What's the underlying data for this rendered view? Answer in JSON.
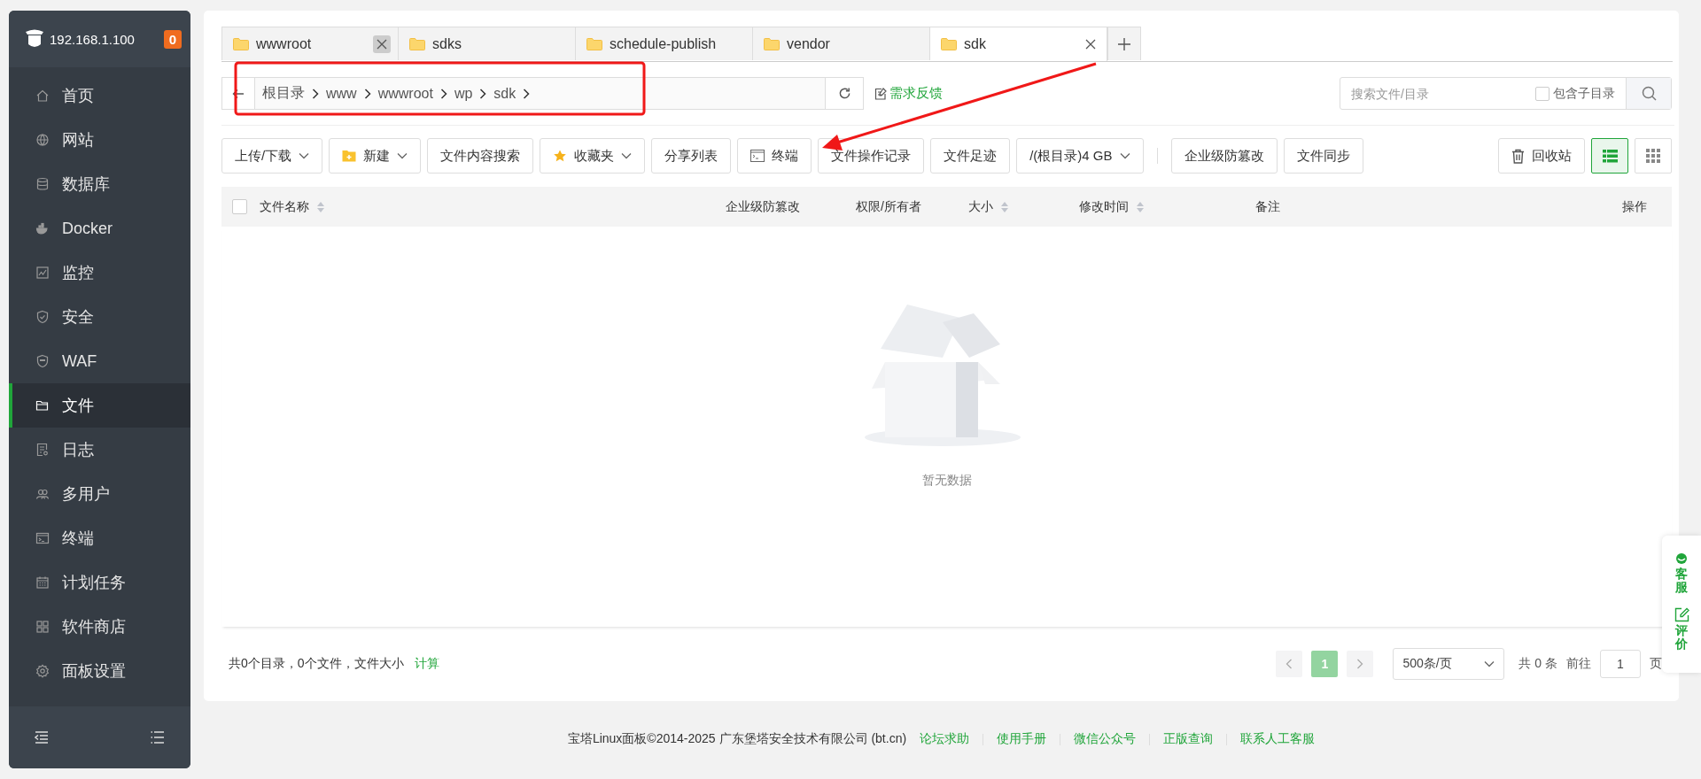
{
  "sidebar": {
    "host": "192.168.1.100",
    "badge": "0",
    "items": [
      {
        "label": "首页",
        "selected": false
      },
      {
        "label": "网站",
        "selected": false
      },
      {
        "label": "数据库",
        "selected": false
      },
      {
        "label": "Docker",
        "selected": false
      },
      {
        "label": "监控",
        "selected": false
      },
      {
        "label": "安全",
        "selected": false
      },
      {
        "label": "WAF",
        "selected": false
      },
      {
        "label": "文件",
        "selected": true
      },
      {
        "label": "日志",
        "selected": false
      },
      {
        "label": "多用户",
        "selected": false
      },
      {
        "label": "终端",
        "selected": false
      },
      {
        "label": "计划任务",
        "selected": false
      },
      {
        "label": "软件商店",
        "selected": false
      },
      {
        "label": "面板设置",
        "selected": false
      }
    ]
  },
  "tabs": [
    {
      "label": "wwwroot",
      "selected": false
    },
    {
      "label": "sdks",
      "selected": false
    },
    {
      "label": "schedule-publish",
      "selected": false
    },
    {
      "label": "vendor",
      "selected": false
    },
    {
      "label": "sdk",
      "selected": true
    }
  ],
  "breadcrumbs": [
    "根目录",
    "www",
    "wwwroot",
    "wp",
    "sdk"
  ],
  "feedback_link": "需求反馈",
  "search": {
    "placeholder": "搜索文件/目录",
    "include_subdirs": {
      "label": "包含子目录",
      "checked": false
    }
  },
  "toolbar": [
    {
      "label": "上传/下载",
      "dropdown": true
    },
    {
      "label": "新建",
      "dropdown": true
    },
    {
      "label": "文件内容搜索",
      "dropdown": false
    },
    {
      "label": "收藏夹",
      "dropdown": true
    },
    {
      "label": "分享列表",
      "dropdown": false
    },
    {
      "label": "终端",
      "dropdown": false
    },
    {
      "label": "文件操作记录",
      "dropdown": false
    },
    {
      "label": "文件足迹",
      "dropdown": false
    },
    {
      "label": "/(根目录)4 GB",
      "dropdown": true
    },
    {
      "label": "企业级防篡改",
      "dropdown": false
    },
    {
      "label": "文件同步",
      "dropdown": false
    }
  ],
  "recycle_button": "回收站",
  "views": [
    {
      "kind": "list",
      "selected": true
    },
    {
      "kind": "grid",
      "selected": false
    }
  ],
  "table": {
    "select_all": false,
    "columns": [
      {
        "label": "文件名称",
        "sortable": true
      },
      {
        "label": "企业级防篡改",
        "sortable": false
      },
      {
        "label": "权限/所有者",
        "sortable": false
      },
      {
        "label": "大小",
        "sortable": true
      },
      {
        "label": "修改时间",
        "sortable": true
      },
      {
        "label": "备注",
        "sortable": false
      },
      {
        "label": "操作",
        "sortable": false
      }
    ],
    "empty_text": "暂无数据"
  },
  "summary": {
    "text": "共0个目录，0个文件，文件大小",
    "link": "计算"
  },
  "pagination": {
    "pages": [
      {
        "label": "1",
        "selected": true
      }
    ],
    "page_size": "500条/页",
    "total": "共 0 条",
    "goto": "前往",
    "page_value": "1",
    "page_unit": "页"
  },
  "footer": {
    "copyright": "宝塔Linux面板©2014-2025 广东堡塔安全技术有限公司 (bt.cn)",
    "links": [
      "论坛求助",
      "使用手册",
      "微信公众号",
      "正版查询",
      "联系人工客服"
    ]
  },
  "float_panel": [
    "客服",
    "评价"
  ]
}
